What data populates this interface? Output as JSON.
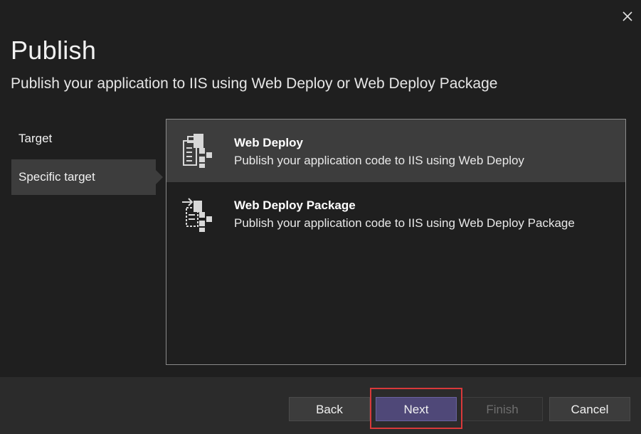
{
  "dialog": {
    "title": "Publish",
    "subtitle": "Publish your application to IIS using Web Deploy or Web Deploy Package"
  },
  "steps": [
    {
      "label": "Target",
      "active": false
    },
    {
      "label": "Specific target",
      "active": true
    }
  ],
  "options": [
    {
      "title": "Web Deploy",
      "description": "Publish your application code to IIS using Web Deploy",
      "icon": "web-deploy-icon",
      "selected": true
    },
    {
      "title": "Web Deploy Package",
      "description": "Publish your application code to IIS using Web Deploy Package",
      "icon": "web-deploy-package-icon",
      "selected": false
    }
  ],
  "buttons": {
    "back": "Back",
    "next": "Next",
    "finish": "Finish",
    "cancel": "Cancel"
  },
  "colors": {
    "background": "#1f1f1f",
    "selected": "#3d3d3d",
    "primary_button": "#4f4878",
    "highlight": "#d9393a"
  }
}
